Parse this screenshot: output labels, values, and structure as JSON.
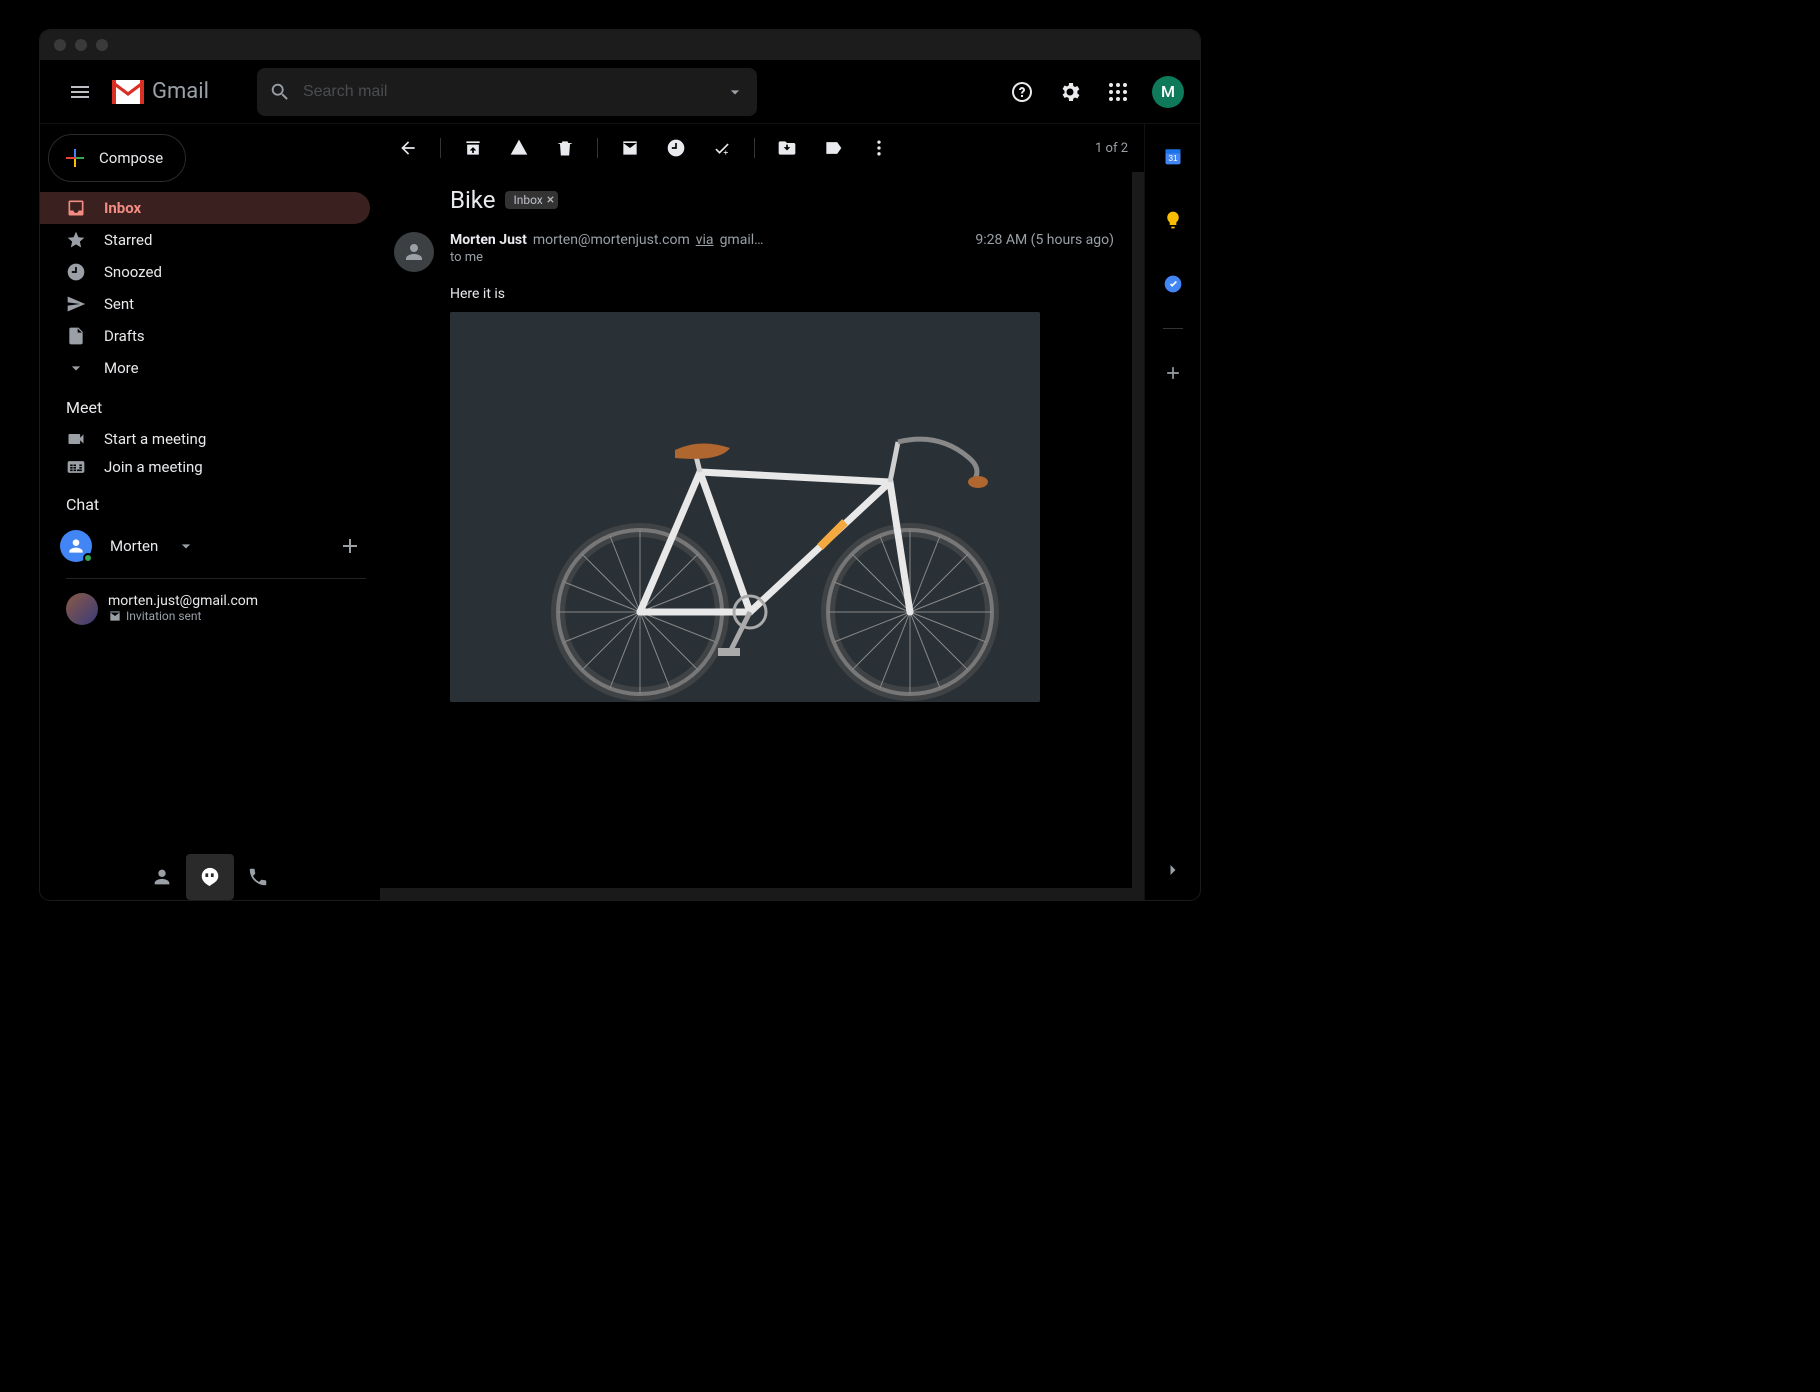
{
  "header": {
    "app_name": "Gmail",
    "search_placeholder": "Search mail",
    "avatar_letter": "M"
  },
  "sidebar": {
    "compose_label": "Compose",
    "nav": [
      {
        "label": "Inbox"
      },
      {
        "label": "Starred"
      },
      {
        "label": "Snoozed"
      },
      {
        "label": "Sent"
      },
      {
        "label": "Drafts"
      },
      {
        "label": "More"
      }
    ],
    "meet": {
      "title": "Meet",
      "start": "Start a meeting",
      "join": "Join a meeting"
    },
    "chat": {
      "title": "Chat",
      "contact_name": "Morten"
    },
    "hangout": {
      "email": "morten.just@gmail.com",
      "status": "Invitation sent"
    }
  },
  "toolbar": {
    "pager": "1 of 2"
  },
  "thread": {
    "subject": "Bike",
    "label": "Inbox",
    "sender_name": "Morten Just",
    "sender_email": "morten@mortenjust.com",
    "via_text": "via",
    "via_domain": "gmail…",
    "timestamp": "9:28 AM (5 hours ago)",
    "to": "to me",
    "body": "Here it is"
  },
  "right_rail": {
    "calendar_day": "31"
  }
}
